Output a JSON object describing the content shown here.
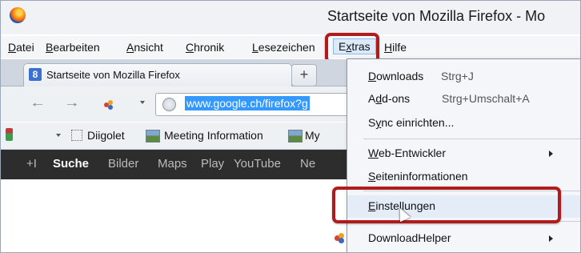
{
  "window": {
    "title": "Startseite von Mozilla Firefox - Mo"
  },
  "menubar": {
    "items": [
      {
        "label": "Datei",
        "accel": "D",
        "rest": "atei"
      },
      {
        "label": "Bearbeiten",
        "accel": "B",
        "rest": "earbeiten"
      },
      {
        "label": "Ansicht",
        "accel": "A",
        "rest": "nsicht"
      },
      {
        "label": "Chronik",
        "accel": "C",
        "rest": "hronik"
      },
      {
        "label": "Lesezeichen",
        "accel": "L",
        "rest": "esezeichen"
      },
      {
        "label": "Extras",
        "pre": "E",
        "accel": "x",
        "rest": "tras"
      },
      {
        "label": "Hilfe",
        "accel": "H",
        "rest": "ilfe"
      }
    ]
  },
  "tabs": [
    {
      "label": "Startseite von Mozilla Firefox",
      "favicon": "8"
    }
  ],
  "newtab_label": "+",
  "navbar": {
    "url": "www.google.ch/firefox?g"
  },
  "bookmarks": [
    {
      "label": "Diigolet"
    },
    {
      "label": "Meeting Information"
    },
    {
      "label": "My"
    }
  ],
  "google_bar": {
    "items": [
      "+I",
      "Suche",
      "Bilder",
      "Maps",
      "Play",
      "YouTube",
      "Ne"
    ],
    "active": "Suche"
  },
  "extras_menu": {
    "items": [
      {
        "pre": "",
        "accel": "D",
        "rest": "ownloads",
        "shortcut": "Strg+J"
      },
      {
        "pre": "A",
        "accel": "d",
        "rest": "d-ons",
        "shortcut": "Strg+Umschalt+A"
      },
      {
        "pre": "S",
        "accel": "y",
        "rest": "nc einrichten...",
        "shortcut": ""
      },
      {
        "pre": "",
        "accel": "W",
        "rest": "eb-Entwickler",
        "shortcut": ""
      },
      {
        "pre": "",
        "accel": "S",
        "rest": "eiteninformationen",
        "shortcut": ""
      },
      {
        "pre": "",
        "accel": "E",
        "rest": "instellungen",
        "shortcut": ""
      },
      {
        "pre": "",
        "accel": "",
        "rest": "DownloadHelper",
        "shortcut": ""
      }
    ]
  },
  "colors": {
    "highlight_ring": "#b01b1b",
    "url_selection": "#3399ff",
    "google_bar": "#2d2d2d"
  }
}
